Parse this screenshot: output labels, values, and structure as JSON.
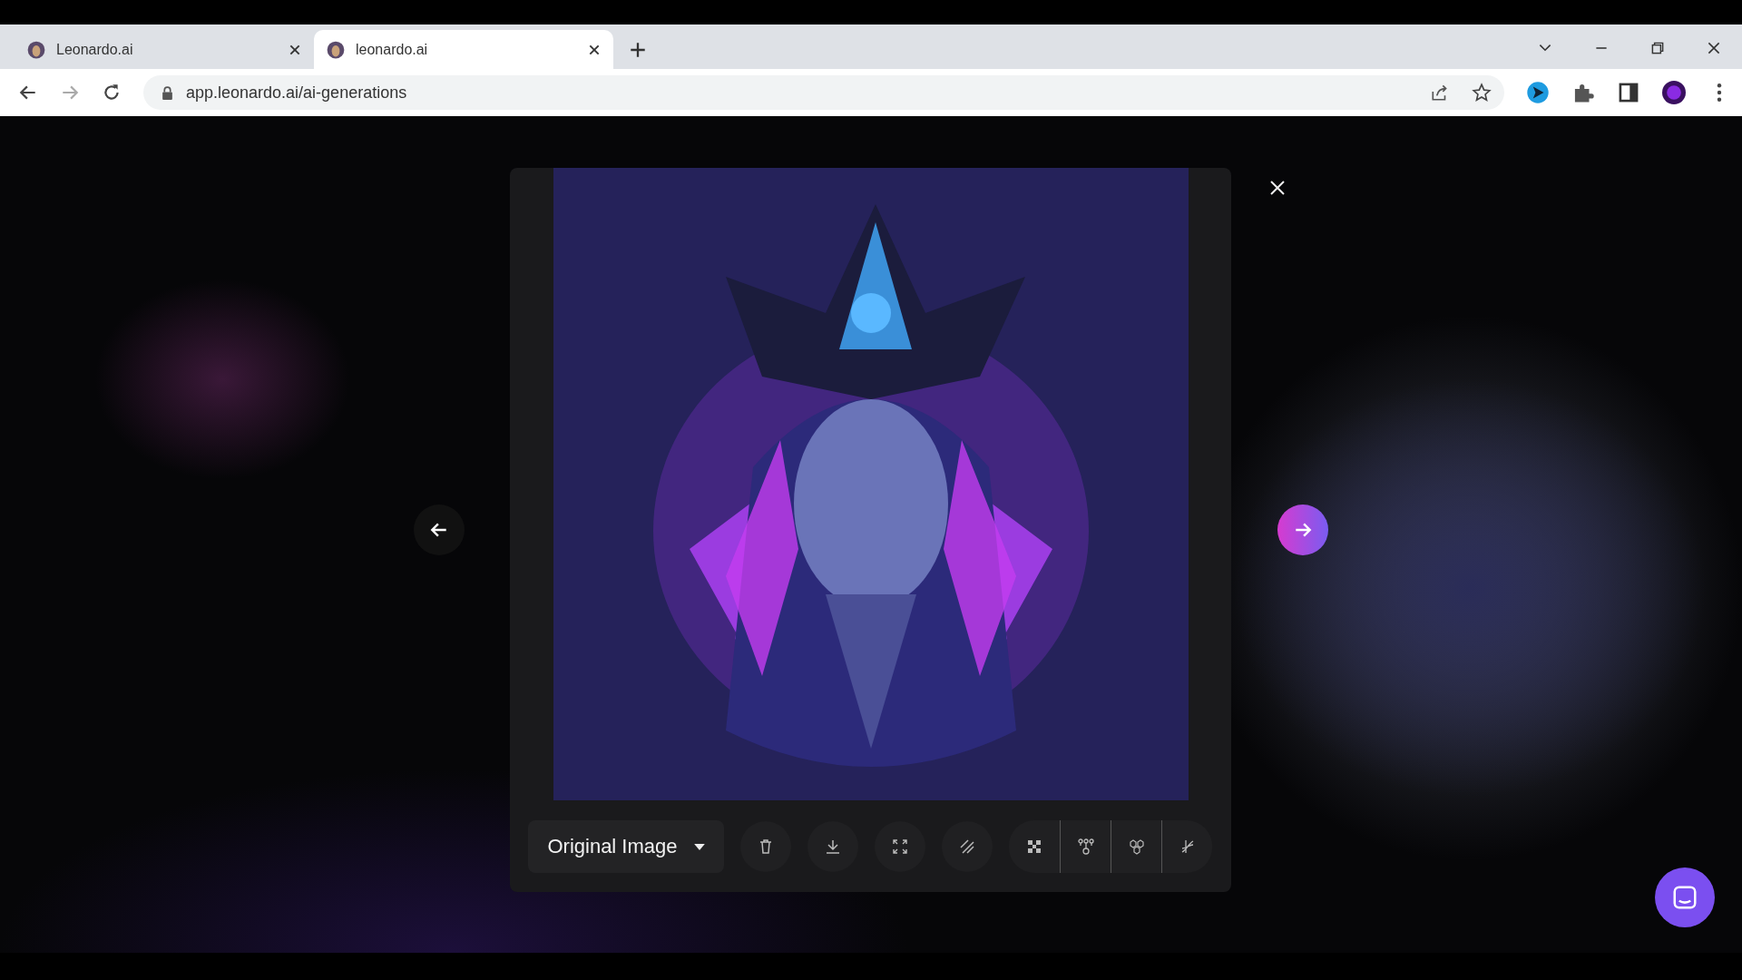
{
  "browser": {
    "tabs": [
      {
        "title": "Leonardo.ai",
        "selected": false
      },
      {
        "title": "leonardo.ai",
        "selected": true
      }
    ],
    "address": "app.leonardo.ai/ai-generations"
  },
  "viewer": {
    "version_select": {
      "value": "Original Image"
    }
  }
}
